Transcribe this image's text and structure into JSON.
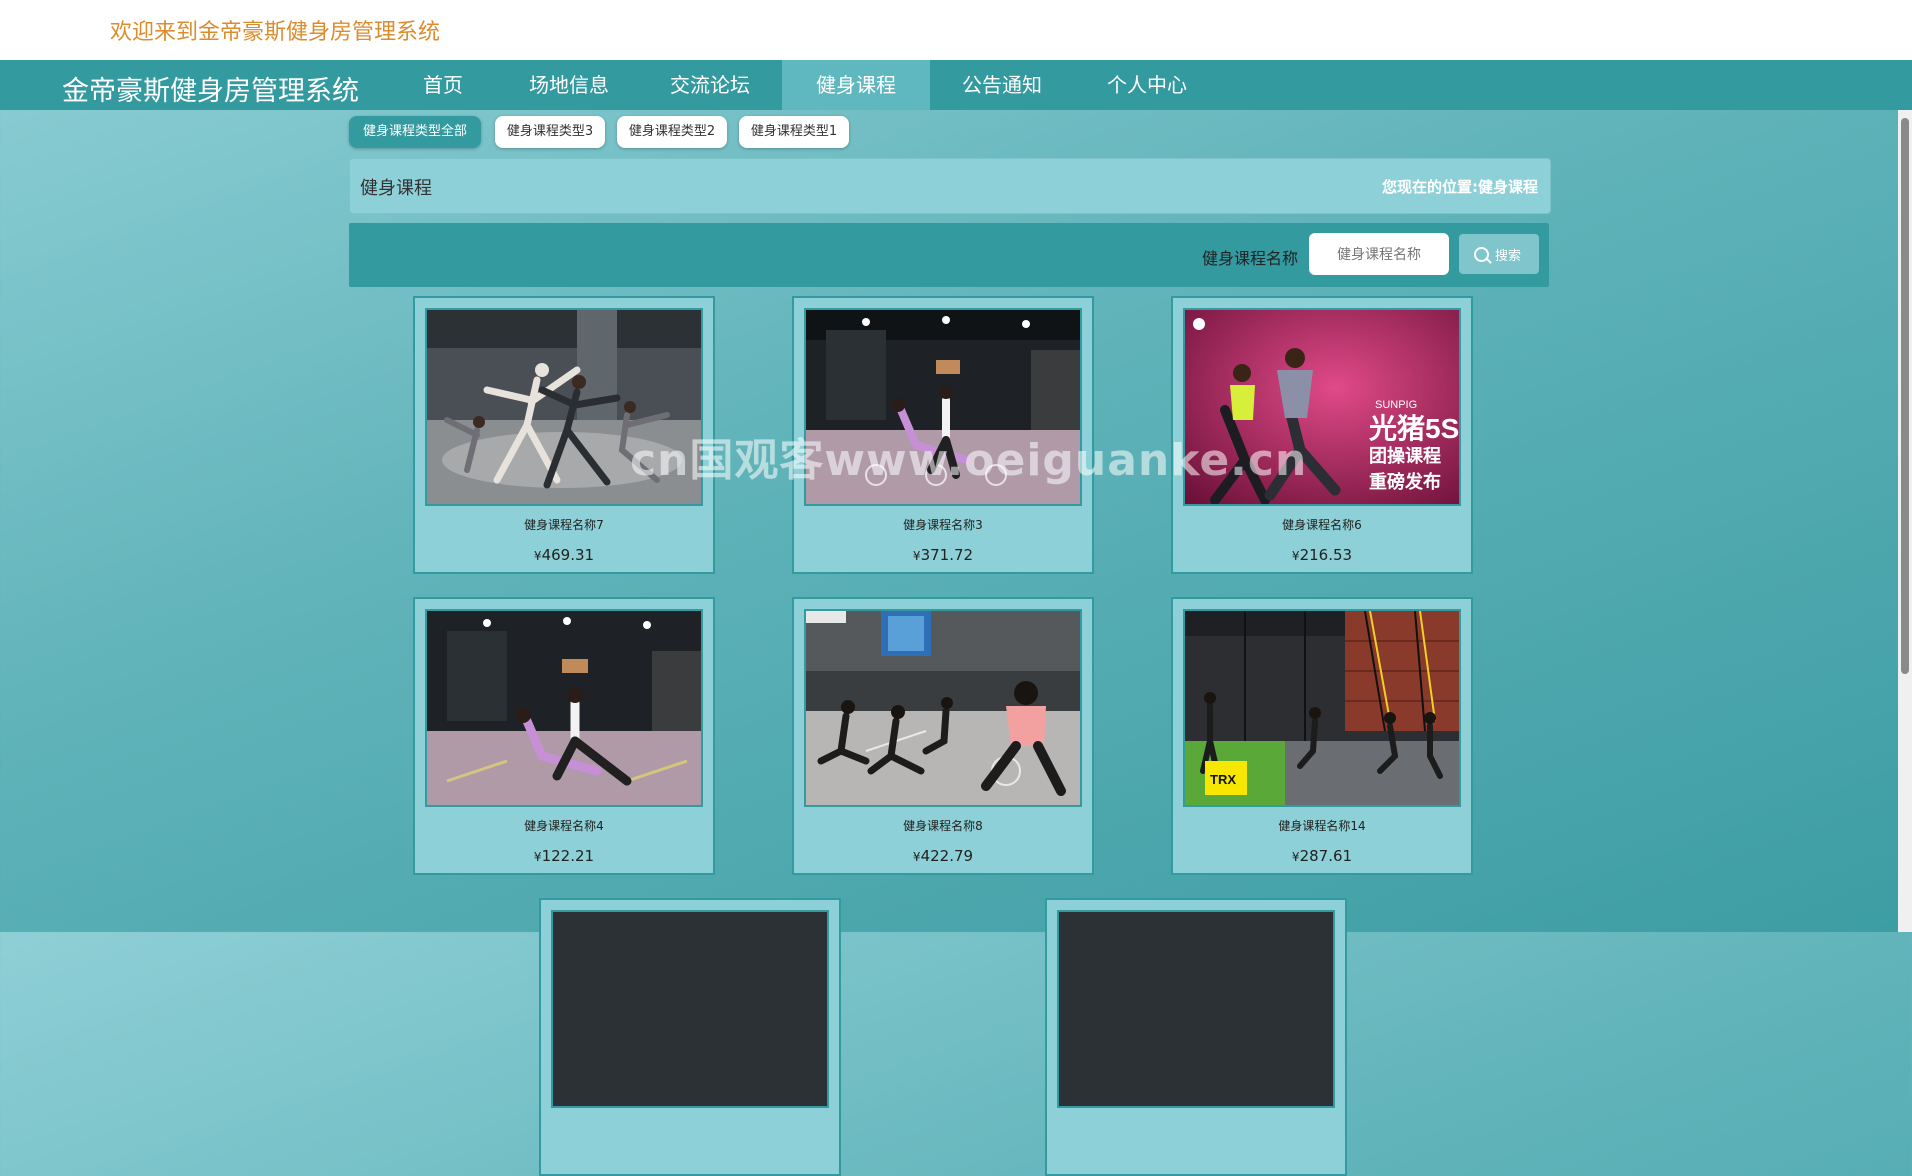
{
  "header": {
    "welcome": "欢迎来到金帝豪斯健身房管理系统"
  },
  "nav": {
    "brand": "金帝豪斯健身房管理系统",
    "items": [
      {
        "label": "首页"
      },
      {
        "label": "场地信息"
      },
      {
        "label": "交流论坛"
      },
      {
        "label": "健身课程",
        "active": true
      },
      {
        "label": "公告通知"
      },
      {
        "label": "个人中心"
      }
    ]
  },
  "categories": [
    {
      "label": "健身课程类型全部",
      "active": true
    },
    {
      "label": "健身课程类型3"
    },
    {
      "label": "健身课程类型2"
    },
    {
      "label": "健身课程类型1"
    }
  ],
  "breadcrumb": {
    "title": "健身课程",
    "location_prefix": "您现在的位置:",
    "location": "健身课程"
  },
  "search": {
    "label": "健身课程名称",
    "placeholder": "健身课程名称",
    "button": "搜索"
  },
  "currency": "¥",
  "courses": [
    {
      "name": "健身课程名称7",
      "price": "469.31"
    },
    {
      "name": "健身课程名称3",
      "price": "371.72"
    },
    {
      "name": "健身课程名称6",
      "price": "216.53"
    },
    {
      "name": "健身课程名称4",
      "price": "122.21"
    },
    {
      "name": "健身课程名称8",
      "price": "422.79"
    },
    {
      "name": "健身课程名称14",
      "price": "287.61"
    }
  ],
  "poster": {
    "brand": "SUNPIG",
    "line1": "光猪5S",
    "line2": "团操课程",
    "line3": "重磅发布"
  },
  "trx_logo": "TRX",
  "watermark": "cn国观客www.oeiguanke.cn",
  "colors": {
    "accent": "#339aa0",
    "panel": "#8dd0d7",
    "welcome": "#dc8c2c"
  }
}
